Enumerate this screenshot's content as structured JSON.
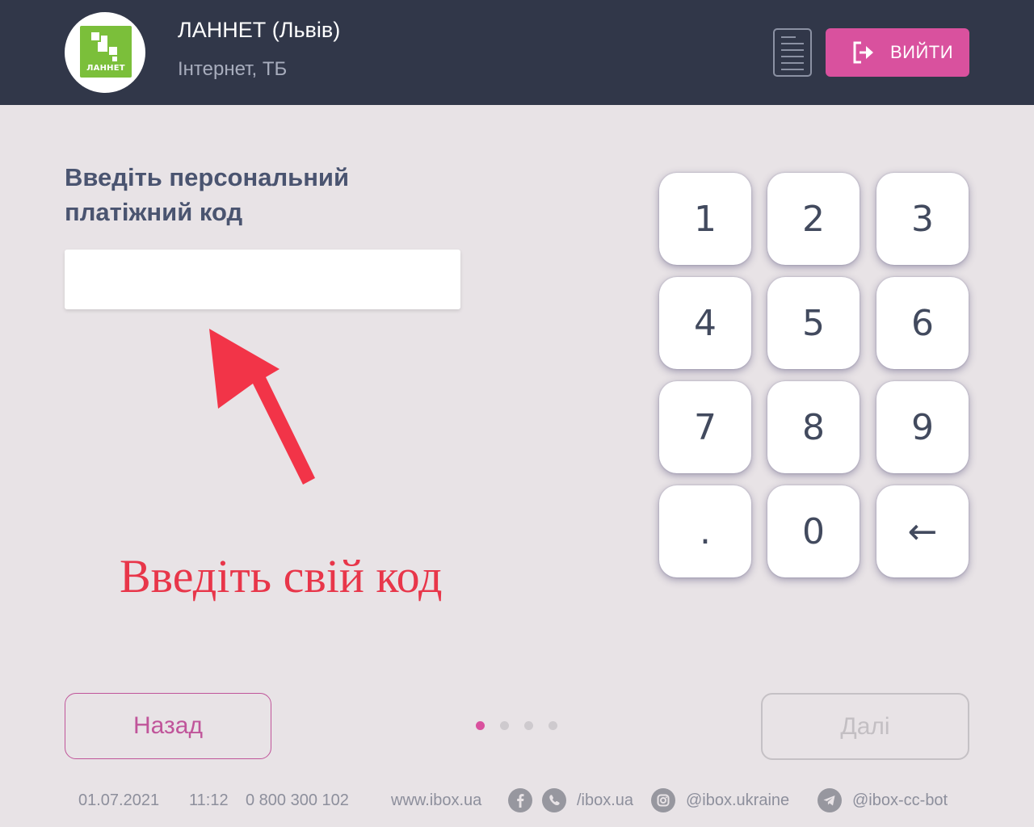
{
  "header": {
    "logo_text": "ЛАННЕТ",
    "provider_name": "ЛАННЕТ (Львів)",
    "provider_category": "Інтернет, ТБ",
    "exit_label": "ВИЙТИ"
  },
  "main": {
    "prompt": "Введіть персональний платіжний код",
    "input_value": "",
    "annotation": "Введіть свій код"
  },
  "keypad": {
    "keys": [
      "1",
      "2",
      "3",
      "4",
      "5",
      "6",
      "7",
      "8",
      "9",
      ".",
      "0",
      "←"
    ]
  },
  "navigation": {
    "back_label": "Назад",
    "next_label": "Далі",
    "page_total": 4,
    "page_current": 1
  },
  "footer": {
    "date": "01.07.2021",
    "time": "11:12",
    "phone": "0 800 300 102",
    "website": "www.ibox.ua",
    "facebook_viber": "/ibox.ua",
    "instagram": "@ibox.ukraine",
    "telegram": "@ibox-cc-bot"
  },
  "colors": {
    "header_bg": "#313749",
    "page_bg": "#e8e3e6",
    "accent": "#d9519e",
    "annotation": "#e8364a",
    "brand_green": "#7bbf3a"
  },
  "icons": [
    "lannet-logo",
    "receipt-icon",
    "exit-icon",
    "red-arrow-icon",
    "facebook-icon",
    "viber-icon",
    "instagram-icon",
    "telegram-icon"
  ]
}
